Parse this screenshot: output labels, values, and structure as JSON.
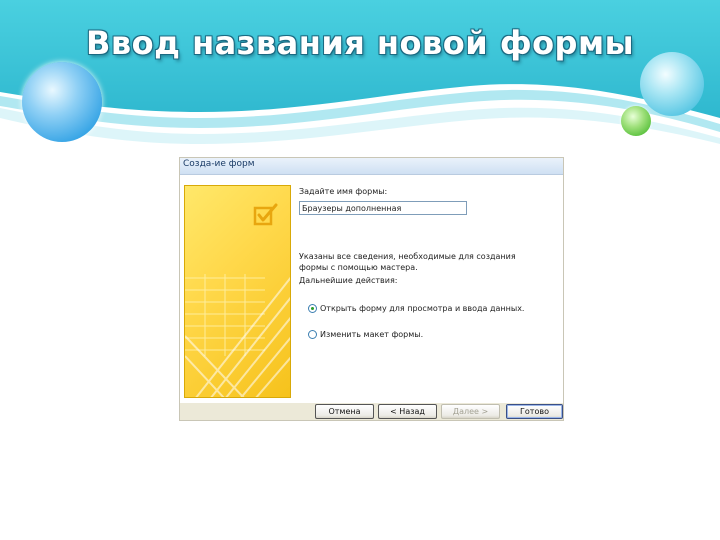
{
  "slide": {
    "title": "Ввод названия новой формы"
  },
  "dialog": {
    "title": "Созда-ие форм",
    "field_label": "Задайте имя формы:",
    "name_value": "Браузеры дополненная",
    "info_text": "Указаны все сведения, необходимые для создания формы с помощью мастера.",
    "next_label": "Дальнейшие действия:",
    "options": [
      {
        "label": "Открыть форму для просмотра и ввода данных.",
        "checked": true
      },
      {
        "label": "Изменить макет формы.",
        "checked": false
      }
    ],
    "buttons": {
      "cancel": "Отмена",
      "back": "< Назад",
      "next": "Далее >",
      "finish": "Готово"
    }
  },
  "colors": {
    "header_teal": "#3cc7d9",
    "dialog_bg": "#ece9d8",
    "art_yellow": "#ffd84a",
    "check_orange": "#e8a60f"
  }
}
